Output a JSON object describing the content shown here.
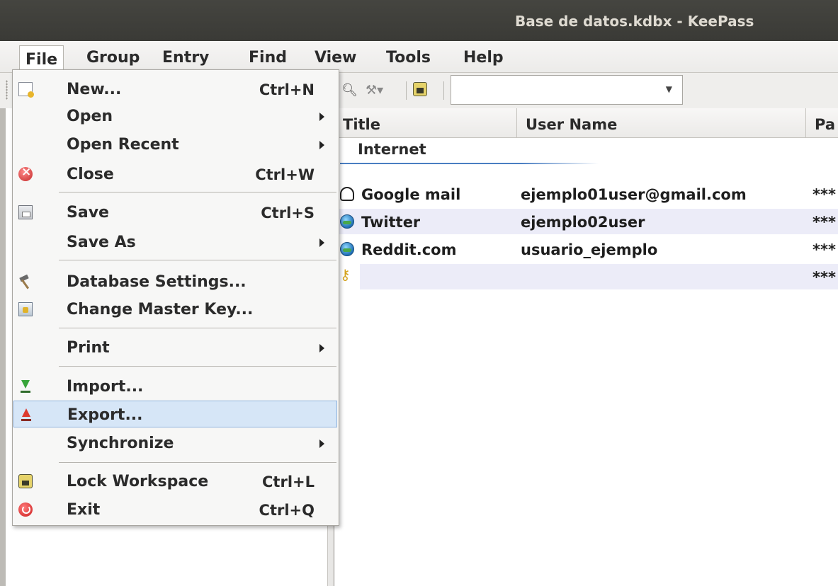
{
  "window": {
    "title": "Base de datos.kdbx - KeePass"
  },
  "menubar": {
    "items": [
      {
        "label": "File",
        "open": true
      },
      {
        "label": "Group"
      },
      {
        "label": "Entry"
      },
      {
        "label": "Find"
      },
      {
        "label": "View"
      },
      {
        "label": "Tools"
      },
      {
        "label": "Help"
      }
    ]
  },
  "file_menu": {
    "items": [
      {
        "label": "New...",
        "shortcut": "Ctrl+N",
        "icon": "new-database-icon"
      },
      {
        "label": "Open",
        "submenu": true
      },
      {
        "label": "Open Recent",
        "submenu": true
      },
      {
        "label": "Close",
        "shortcut": "Ctrl+W",
        "icon": "close-icon"
      },
      {
        "label": "Save",
        "shortcut": "Ctrl+S",
        "icon": "save-icon"
      },
      {
        "label": "Save As",
        "submenu": true
      },
      {
        "label": "Database Settings...",
        "icon": "hammer-icon"
      },
      {
        "label": "Change Master Key...",
        "icon": "master-key-icon"
      },
      {
        "label": "Print",
        "submenu": true
      },
      {
        "label": "Import...",
        "icon": "import-icon"
      },
      {
        "label": "Export...",
        "icon": "export-icon",
        "highlighted": true
      },
      {
        "label": "Synchronize",
        "submenu": true
      },
      {
        "label": "Lock Workspace",
        "shortcut": "Ctrl+L",
        "icon": "lock-icon"
      },
      {
        "label": "Exit",
        "shortcut": "Ctrl+Q",
        "icon": "exit-icon"
      }
    ]
  },
  "toolbar": {
    "search_combo_value": "",
    "icons": [
      "find-icon",
      "key-dropdown-icon",
      "lock-workspace-icon"
    ]
  },
  "entry_list": {
    "columns": [
      "Title",
      "User Name",
      "Pa"
    ],
    "group_label": "Internet",
    "rows": [
      {
        "title": "Google mail",
        "user": "ejemplo01user@gmail.com",
        "password": "***",
        "icon": "linux-icon"
      },
      {
        "title": "Twitter",
        "user": "ejemplo02user",
        "password": "***",
        "icon": "globe-icon"
      },
      {
        "title": "Reddit.com",
        "user": "usuario_ejemplo",
        "password": "***",
        "icon": "globe-icon"
      },
      {
        "title": "",
        "user": "",
        "password": "***",
        "icon": "key-icon"
      }
    ]
  },
  "colors": {
    "highlight_bg": "#d6e6f7",
    "highlight_border": "#8fb3de",
    "alt_row": "#ececf8",
    "titlebar": "#3c3b37"
  }
}
